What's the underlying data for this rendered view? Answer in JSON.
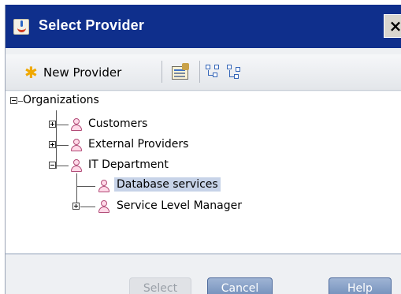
{
  "dialog": {
    "title": "Select Provider",
    "close_glyph": "×",
    "title_icon": "java-cup-icon"
  },
  "toolbar": {
    "new_provider_label": "New Provider",
    "new_provider_icon": "asterisk-icon",
    "properties_icon": "properties-icon",
    "expand_all_icon": "expand-all-icon",
    "collapse_all_icon": "collapse-all-icon"
  },
  "tree": {
    "root": {
      "label": "Organizations",
      "expanded": true
    },
    "items": [
      {
        "label": "Customers",
        "expanded": false
      },
      {
        "label": "External Providers",
        "expanded": false
      },
      {
        "label": "IT Department",
        "expanded": true
      },
      {
        "label": "Database services",
        "selected": true
      },
      {
        "label": "Service Level Manager",
        "expanded": false
      }
    ]
  },
  "buttons": {
    "select": "Select",
    "cancel": "Cancel",
    "help": "Help"
  },
  "colors": {
    "titlebar": "#0f2f8c",
    "selection": "#c7d3e8",
    "button_blue": "#6d8bb8"
  }
}
